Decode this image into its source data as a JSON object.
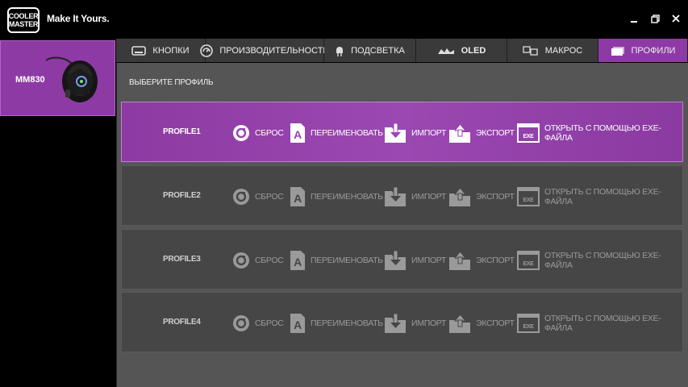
{
  "header": {
    "logo_line1": "COOLER",
    "logo_line2": "MASTER",
    "tagline": "Make It Yours.",
    "controls": [
      "minimize-icon",
      "restore-icon",
      "close-icon"
    ]
  },
  "device": {
    "name": "MM830"
  },
  "tabs": [
    {
      "label": "КНОПКИ",
      "icon": "keyboard-icon"
    },
    {
      "label": "ПРОИЗВОДИТЕЛЬНОСТЬ",
      "icon": "gauge-icon"
    },
    {
      "label": "ПОДСВЕТКА",
      "icon": "led-icon"
    },
    {
      "label": "OLED",
      "icon": "oled-screen-icon"
    },
    {
      "label": "МАКРОС",
      "icon": "macro-keys-icon"
    },
    {
      "label": "ПРОФИЛИ",
      "icon": "profile-folder-icon",
      "active": true
    }
  ],
  "main": {
    "heading": "ВЫБЕРИТЕ ПРОФИЛЬ"
  },
  "profiles": [
    {
      "name": "PROFILE1",
      "active": true
    },
    {
      "name": "PROFILE2",
      "active": false
    },
    {
      "name": "PROFILE3",
      "active": false
    },
    {
      "name": "PROFILE4",
      "active": false
    }
  ],
  "actions": {
    "reset": "СБРОС",
    "rename": "ПЕРЕИМЕНОВАТЬ",
    "import": "ИМПОРТ",
    "export": "ЭКСПОРТ",
    "open_exe": "ОТКРЫТЬ С ПОМОЩЬЮ EXE-ФАЙЛА",
    "exe_badge": "EXE"
  },
  "colors": {
    "accent": "#8e3aa5",
    "panel": "#555555",
    "row": "#464646"
  }
}
